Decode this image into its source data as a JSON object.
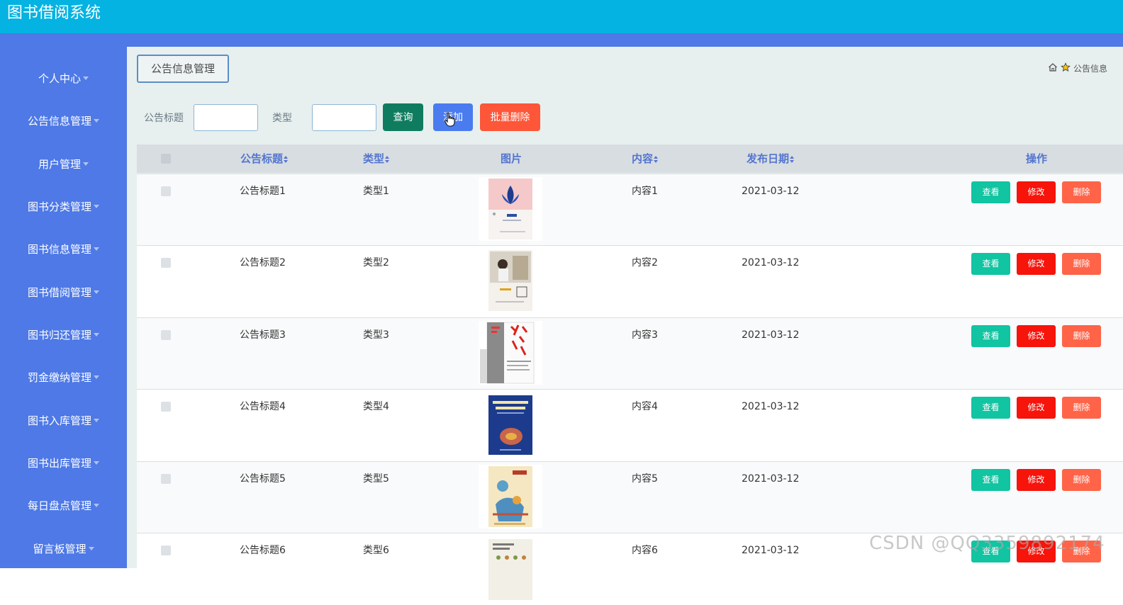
{
  "app": {
    "title": "图书借阅系统"
  },
  "sidebar": {
    "items": [
      {
        "label": "个人中心"
      },
      {
        "label": "公告信息管理"
      },
      {
        "label": "用户管理"
      },
      {
        "label": "图书分类管理"
      },
      {
        "label": "图书信息管理"
      },
      {
        "label": "图书借阅管理"
      },
      {
        "label": "图书归还管理"
      },
      {
        "label": "罚金缴纳管理"
      },
      {
        "label": "图书入库管理"
      },
      {
        "label": "图书出库管理"
      },
      {
        "label": "每日盘点管理"
      },
      {
        "label": "留言板管理"
      }
    ]
  },
  "breadcrumb": {
    "current": "公告信息管理",
    "right_text": "公告信息"
  },
  "search": {
    "title_label": "公告标题",
    "title_value": "",
    "type_label": "类型",
    "type_value": "",
    "query_label": "查询",
    "add_label": "添加",
    "batch_delete_label": "批量删除"
  },
  "table": {
    "columns": [
      "公告标题",
      "类型",
      "图片",
      "内容",
      "发布日期",
      "操作"
    ],
    "actions": {
      "view": "查看",
      "edit": "修改",
      "delete": "删除"
    },
    "rows": [
      {
        "title": "公告标题1",
        "type": "类型1",
        "content": "内容1",
        "date": "2021-03-12"
      },
      {
        "title": "公告标题2",
        "type": "类型2",
        "content": "内容2",
        "date": "2021-03-12"
      },
      {
        "title": "公告标题3",
        "type": "类型3",
        "content": "内容3",
        "date": "2021-03-12"
      },
      {
        "title": "公告标题4",
        "type": "类型4",
        "content": "内容4",
        "date": "2021-03-12"
      },
      {
        "title": "公告标题5",
        "type": "类型5",
        "content": "内容5",
        "date": "2021-03-12"
      },
      {
        "title": "公告标题6",
        "type": "类型6",
        "content": "内容6",
        "date": "2021-03-12"
      }
    ]
  },
  "watermark": "CSDN @QQ3359892174",
  "colors": {
    "topbar": "#04b3e1",
    "sidebar": "#4e79e6",
    "query": "#0f7c60",
    "add": "#4a7cf0",
    "danger": "#fd5638",
    "view": "#11c4a2",
    "edit": "#f6140b"
  }
}
